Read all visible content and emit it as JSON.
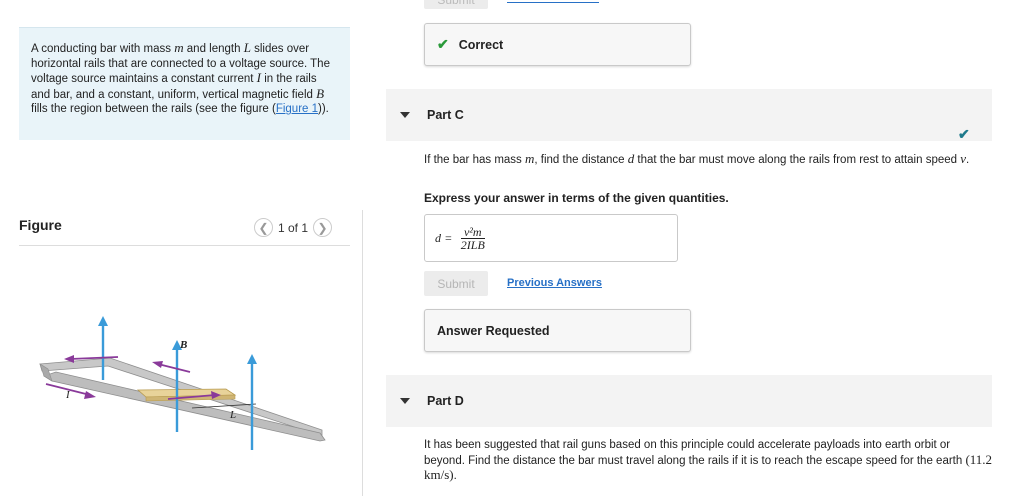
{
  "problem": {
    "text_1": "A conducting bar with mass ",
    "var_m": "m",
    "text_2": " and length ",
    "var_L": "L",
    "text_3": " slides over horizontal rails that are connected to a voltage source. The voltage source maintains a constant current ",
    "var_I": "I",
    "text_4": " in the rails and bar, and a constant, uniform, vertical magnetic field ",
    "var_B": "B",
    "text_5": " fills the region between the rails (see the figure (",
    "figure_link": "Figure 1",
    "text_6": "))."
  },
  "figure": {
    "title": "Figure",
    "pager_text": "1 of 1",
    "prev_icon": "chevron-left-icon",
    "next_icon": "chevron-right-icon",
    "labels": {
      "B": "B",
      "I": "I",
      "L": "L"
    },
    "colors": {
      "rail": "#b9b9b9",
      "bar": "#e8d39a",
      "field": "#3a9bd9",
      "current": "#8a3a9a"
    }
  },
  "top_partial": {
    "submit_label": "Submit",
    "prev_label": "Previous Answers"
  },
  "part_b_result": {
    "icon": "check-icon",
    "label": "Correct"
  },
  "part_c": {
    "header": "Part C",
    "question_1": "If the bar has mass ",
    "var_m": "m",
    "question_2": ", find the distance ",
    "var_d": "d",
    "question_3": " that the bar must move along the rails from rest to attain speed ",
    "var_v": "v",
    "question_4": ".",
    "instruction": "Express your answer in terms of the given quantities.",
    "answer_var": "d",
    "answer_eq": "=",
    "answer_numerator": "v²m",
    "answer_denominator": "2ILB",
    "submit_label": "Submit",
    "prev_label": "Previous Answers",
    "result_label": "Answer Requested"
  },
  "part_d": {
    "header": "Part D",
    "question_1": "It has been suggested that rail guns based on this principle could accelerate payloads into earth orbit or beyond. Find the distance the bar must travel along the rails if it is to reach the escape speed for the earth ",
    "speed": "(11.2 km/s)",
    "question_2": "."
  }
}
